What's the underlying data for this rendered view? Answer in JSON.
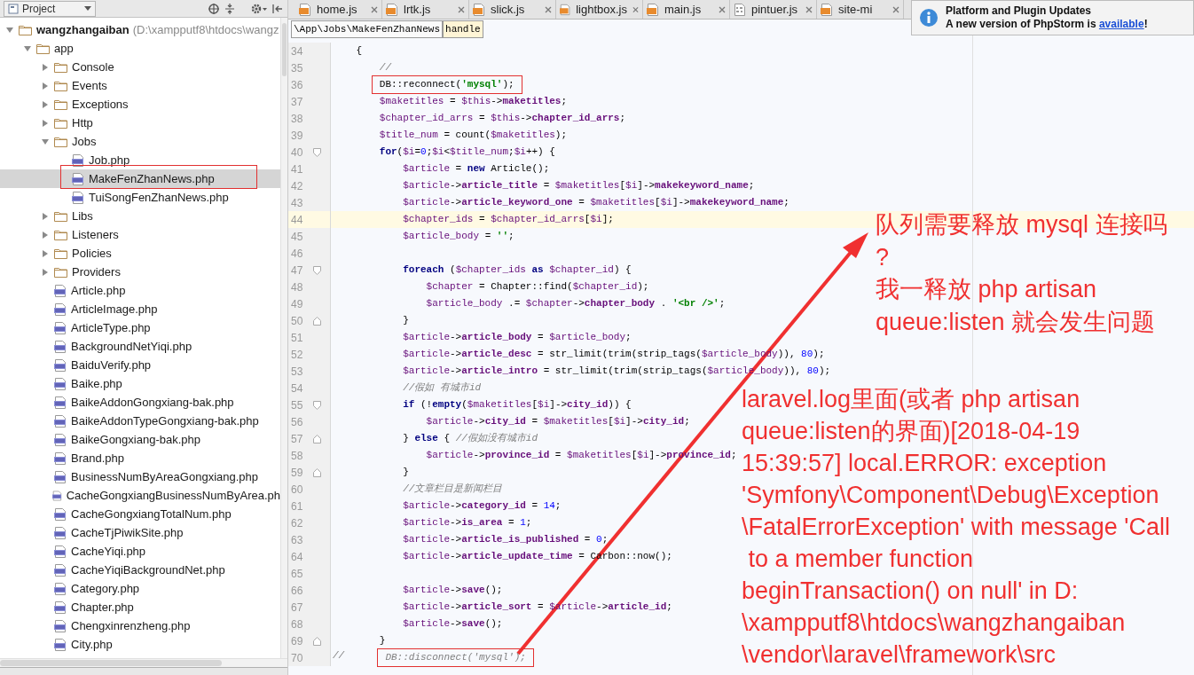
{
  "project_panel": {
    "title": "Project",
    "tree": [
      {
        "label": "wangzhangaiban",
        "path": "(D:\\xampputf8\\htdocs\\wangz",
        "kind": "folder",
        "expanded": true,
        "selected": false,
        "children": [
          {
            "label": "app",
            "kind": "folder",
            "expanded": true,
            "selected": false,
            "children": [
              {
                "label": "Console",
                "kind": "folder",
                "expanded": false,
                "selected": false
              },
              {
                "label": "Events",
                "kind": "folder",
                "expanded": false,
                "selected": false
              },
              {
                "label": "Exceptions",
                "kind": "folder",
                "expanded": false,
                "selected": false
              },
              {
                "label": "Http",
                "kind": "folder",
                "expanded": false,
                "selected": false
              },
              {
                "label": "Jobs",
                "kind": "folder",
                "expanded": true,
                "selected": false,
                "children": [
                  {
                    "label": "Job.php",
                    "kind": "php",
                    "selected": false
                  },
                  {
                    "label": "MakeFenZhanNews.php",
                    "kind": "php",
                    "selected": true
                  },
                  {
                    "label": "TuiSongFenZhanNews.php",
                    "kind": "php",
                    "selected": false
                  }
                ]
              },
              {
                "label": "Libs",
                "kind": "folder",
                "expanded": false,
                "selected": false
              },
              {
                "label": "Listeners",
                "kind": "folder",
                "expanded": false,
                "selected": false
              },
              {
                "label": "Policies",
                "kind": "folder",
                "expanded": false,
                "selected": false
              },
              {
                "label": "Providers",
                "kind": "folder",
                "expanded": false,
                "selected": false
              },
              {
                "label": "Article.php",
                "kind": "php",
                "selected": false
              },
              {
                "label": "ArticleImage.php",
                "kind": "php",
                "selected": false
              },
              {
                "label": "ArticleType.php",
                "kind": "php",
                "selected": false
              },
              {
                "label": "BackgroundNetYiqi.php",
                "kind": "php",
                "selected": false
              },
              {
                "label": "BaiduVerify.php",
                "kind": "php",
                "selected": false
              },
              {
                "label": "Baike.php",
                "kind": "php",
                "selected": false
              },
              {
                "label": "BaikeAddonGongxiang-bak.php",
                "kind": "php",
                "selected": false
              },
              {
                "label": "BaikeAddonTypeGongxiang-bak.php",
                "kind": "php",
                "selected": false
              },
              {
                "label": "BaikeGongxiang-bak.php",
                "kind": "php",
                "selected": false
              },
              {
                "label": "Brand.php",
                "kind": "php",
                "selected": false
              },
              {
                "label": "BusinessNumByAreaGongxiang.php",
                "kind": "php",
                "selected": false
              },
              {
                "label": "CacheGongxiangBusinessNumByArea.ph",
                "kind": "php",
                "selected": false
              },
              {
                "label": "CacheGongxiangTotalNum.php",
                "kind": "php",
                "selected": false
              },
              {
                "label": "CacheTjPiwikSite.php",
                "kind": "php",
                "selected": false
              },
              {
                "label": "CacheYiqi.php",
                "kind": "php",
                "selected": false
              },
              {
                "label": "CacheYiqiBackgroundNet.php",
                "kind": "php",
                "selected": false
              },
              {
                "label": "Category.php",
                "kind": "php",
                "selected": false
              },
              {
                "label": "Chapter.php",
                "kind": "php",
                "selected": false
              },
              {
                "label": "Chengxinrenzheng.php",
                "kind": "php",
                "selected": false
              },
              {
                "label": "City.php",
                "kind": "php",
                "selected": false
              }
            ]
          }
        ]
      }
    ]
  },
  "tabs": [
    {
      "label": "home.js",
      "kind": "js"
    },
    {
      "label": "lrtk.js",
      "kind": "js"
    },
    {
      "label": "slick.js",
      "kind": "js"
    },
    {
      "label": "lightbox.js",
      "kind": "js"
    },
    {
      "label": "main.js",
      "kind": "js"
    },
    {
      "label": "pintuer.js",
      "kind": "binary"
    },
    {
      "label": "site-mi",
      "kind": "js"
    }
  ],
  "breadcrumb": [
    "\\App\\Jobs\\MakeFenZhanNews",
    "handle"
  ],
  "notification": {
    "title": "Platform and Plugin Updates",
    "message": "A new version of PhpStorm is",
    "link": "available",
    "suffix": "!"
  },
  "editor": {
    "lines": [
      {
        "number": "34",
        "text": "    {",
        "current": false,
        "kind": "plain"
      },
      {
        "number": "35",
        "text": "        //",
        "current": false,
        "kind": "plain"
      },
      {
        "number": "36",
        "text": "        DB::reconnect('mysql');",
        "current": false,
        "kind": "plain",
        "boxed": true
      },
      {
        "number": "37",
        "text": "        $maketitles = $this->maketitles;",
        "current": false,
        "kind": "plain"
      },
      {
        "number": "38",
        "text": "        $chapter_id_arrs = $this->chapter_id_arrs;",
        "current": false,
        "kind": "plain"
      },
      {
        "number": "39",
        "text": "        $title_num = count($maketitles);",
        "current": false,
        "kind": "plain"
      },
      {
        "number": "40",
        "text": "        for($i=0;$i<$title_num;$i++) {",
        "current": false,
        "kind": "opener"
      },
      {
        "number": "41",
        "text": "            $article = new Article();",
        "current": false,
        "kind": "plain"
      },
      {
        "number": "42",
        "text": "            $article->article_title = $maketitles[$i]->makekeyword_name;",
        "current": false,
        "kind": "plain"
      },
      {
        "number": "43",
        "text": "            $article->article_keyword_one = $maketitles[$i]->makekeyword_name;",
        "current": false,
        "kind": "plain"
      },
      {
        "number": "44",
        "text": "            $chapter_ids = $chapter_id_arrs[$i];",
        "current": true,
        "kind": "plain"
      },
      {
        "number": "45",
        "text": "            $article_body = '';",
        "current": false,
        "kind": "plain"
      },
      {
        "number": "46",
        "current": false,
        "kind": "plain"
      },
      {
        "number": "47",
        "text": "            foreach ($chapter_ids as $chapter_id) {",
        "current": false,
        "kind": "opener"
      },
      {
        "number": "48",
        "text": "                $chapter = Chapter::find($chapter_id);",
        "current": false,
        "kind": "plain"
      },
      {
        "number": "49",
        "text": "                $article_body .= $chapter->chapter_body . '<br />';",
        "current": false,
        "kind": "plain"
      },
      {
        "number": "50",
        "text": "            }",
        "current": false,
        "kind": "closer"
      },
      {
        "number": "51",
        "text": "            $article->article_body = $article_body;",
        "current": false,
        "kind": "plain"
      },
      {
        "number": "52",
        "text": "            $article->article_desc = str_limit(trim(strip_tags($article_body)), 80);",
        "current": false,
        "kind": "plain"
      },
      {
        "number": "53",
        "text": "            $article->article_intro = str_limit(trim(strip_tags($article_body)), 80);",
        "current": false,
        "kind": "plain"
      },
      {
        "number": "54",
        "text": "            //假如 有城市id",
        "current": false,
        "kind": "plain"
      },
      {
        "number": "55",
        "text": "            if (!empty($maketitles[$i]->city_id)) {",
        "current": false,
        "kind": "opener"
      },
      {
        "number": "56",
        "text": "                $article->city_id = $maketitles[$i]->city_id;",
        "current": false,
        "kind": "plain"
      },
      {
        "number": "57",
        "text": "            } else { //假如没有城市id",
        "current": false,
        "kind": "closer"
      },
      {
        "number": "58",
        "text": "                $article->province_id = $maketitles[$i]->province_id;",
        "current": false,
        "kind": "plain"
      },
      {
        "number": "59",
        "text": "            }",
        "current": false,
        "kind": "closer"
      },
      {
        "number": "60",
        "text": "            //文章栏目是新闻栏目",
        "current": false,
        "kind": "plain"
      },
      {
        "number": "61",
        "text": "            $article->category_id = 14;",
        "current": false,
        "kind": "plain"
      },
      {
        "number": "62",
        "text": "            $article->is_area = 1;",
        "current": false,
        "kind": "plain"
      },
      {
        "number": "63",
        "text": "            $article->article_is_published = 0;",
        "current": false,
        "kind": "plain"
      },
      {
        "number": "64",
        "text": "            $article->article_update_time = Carbon::now();",
        "current": false,
        "kind": "plain"
      },
      {
        "number": "65",
        "current": false,
        "kind": "plain"
      },
      {
        "number": "66",
        "text": "            $article->save();",
        "current": false,
        "kind": "plain"
      },
      {
        "number": "67",
        "text": "            $article->article_sort = $article->article_id;",
        "current": false,
        "kind": "plain"
      },
      {
        "number": "68",
        "text": "            $article->save();",
        "current": false,
        "kind": "plain"
      },
      {
        "number": "69",
        "text": "        }",
        "current": false,
        "kind": "closer"
      },
      {
        "number": "70",
        "text": "//       DB::disconnect('mysql');",
        "current": false,
        "kind": "plain",
        "boxed": true
      }
    ]
  },
  "annotations": [
    {
      "text": "队列需要释放 mysql 连接吗\n?\n我一释放 php artisan\nqueue:listen 就会发生问题"
    },
    {
      "text": "laravel.log里面(或者 php artisan\nqueue:listen的界面)[2018-04-19\n15:39:57] local.ERROR: exception\n'Symfony\\Component\\Debug\\Exception\n\\FatalErrorException' with message 'Call\n to a member function\nbeginTransaction() on null' in D:\n\\xampputf8\\htdocs\\wangzhangaiban\n\\vendor\\laravel\\framework\\src"
    }
  ]
}
